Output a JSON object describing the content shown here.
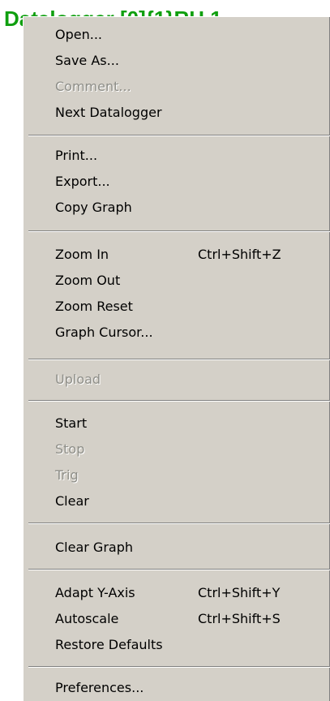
{
  "window": {
    "title_text": "Datalogger [0]{1}RH 1"
  },
  "menu": {
    "open": {
      "label": "Open..."
    },
    "save_as": {
      "label": "Save As..."
    },
    "comment": {
      "label": "Comment..."
    },
    "next_datalogger": {
      "label": "Next Datalogger"
    },
    "print": {
      "label": "Print..."
    },
    "export": {
      "label": "Export..."
    },
    "copy_graph": {
      "label": "Copy Graph"
    },
    "zoom_in": {
      "label": "Zoom In",
      "shortcut": "Ctrl+Shift+Z"
    },
    "zoom_out": {
      "label": "Zoom Out"
    },
    "zoom_reset": {
      "label": "Zoom Reset"
    },
    "graph_cursor": {
      "label": "Graph Cursor..."
    },
    "upload": {
      "label": "Upload"
    },
    "start": {
      "label": "Start"
    },
    "stop": {
      "label": "Stop"
    },
    "trig": {
      "label": "Trig"
    },
    "clear": {
      "label": "Clear"
    },
    "clear_graph": {
      "label": "Clear Graph"
    },
    "adapt_y_axis": {
      "label": "Adapt Y-Axis",
      "shortcut": "Ctrl+Shift+Y"
    },
    "autoscale": {
      "label": "Autoscale",
      "shortcut": "Ctrl+Shift+S"
    },
    "restore_defaults": {
      "label": "Restore Defaults"
    },
    "preferences": {
      "label": "Preferences..."
    }
  },
  "colors": {
    "menu_background": "#d4d0c8",
    "disabled_text": "#8e8e88",
    "title_green": "#0f9f0f"
  }
}
